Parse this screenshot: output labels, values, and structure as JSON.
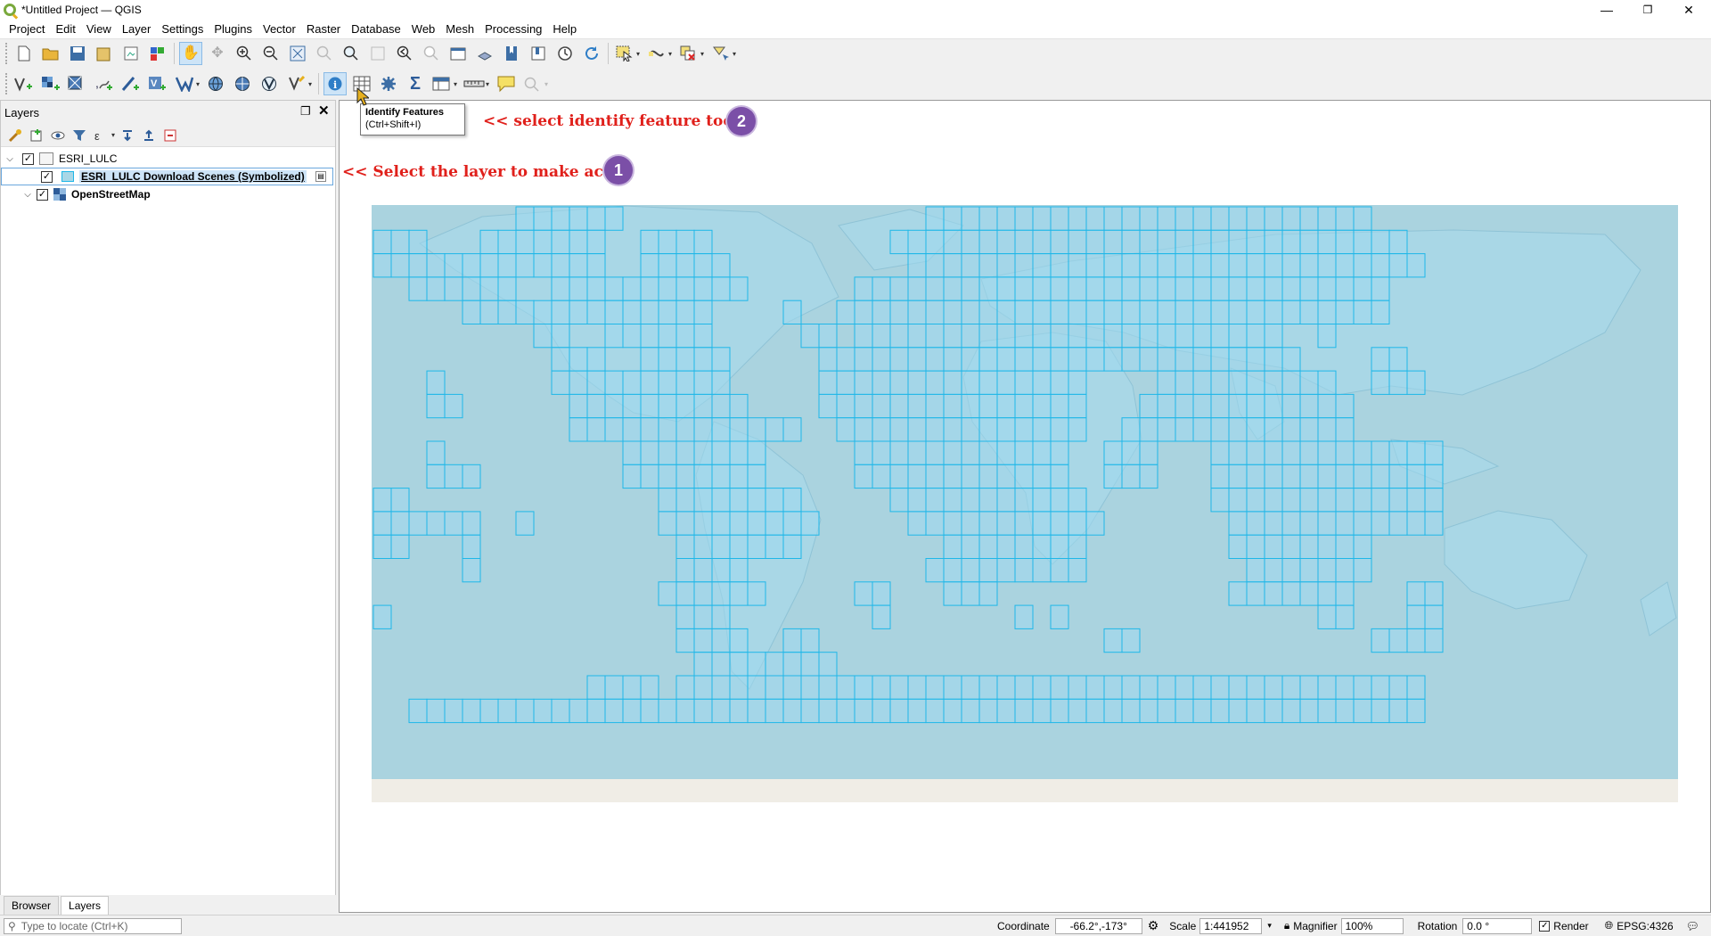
{
  "window": {
    "title": "*Untitled Project — QGIS",
    "minimize": "—",
    "restore": "❐",
    "close": "✕"
  },
  "menu": [
    "Project",
    "Edit",
    "View",
    "Layer",
    "Settings",
    "Plugins",
    "Vector",
    "Raster",
    "Database",
    "Web",
    "Mesh",
    "Processing",
    "Help"
  ],
  "panel": {
    "title": "Layers",
    "layers": {
      "group": "ESRI_LULC",
      "active_layer": "ESRI_LULC Download Scenes (Symbolized)",
      "basemap": "OpenStreetMap"
    }
  },
  "tabs": [
    "Browser",
    "Layers"
  ],
  "tooltip": {
    "title": "Identify Features",
    "shortcut": "(Ctrl+Shift+I)"
  },
  "annotations": {
    "step2_text": "<< select identify feature tool",
    "step2_num": "2",
    "step1_text": "<< Select the layer to make active",
    "step1_num": "1"
  },
  "status": {
    "locate_placeholder": "Type to locate (Ctrl+K)",
    "coordinate_label": "Coordinate",
    "coordinate_value": "-66.2°,-173°",
    "scale_label": "Scale",
    "scale_value": "1:441952",
    "magnifier_label": "Magnifier",
    "magnifier_value": "100%",
    "rotation_label": "Rotation",
    "rotation_value": "0.0 °",
    "render_label": "Render",
    "crs": "EPSG:4326"
  },
  "map": {
    "ocean_color": "#aad3df",
    "land_color": "#a9d7e6",
    "tile_fill": "#9fd9ee",
    "tile_stroke": "#1fb7e8"
  }
}
